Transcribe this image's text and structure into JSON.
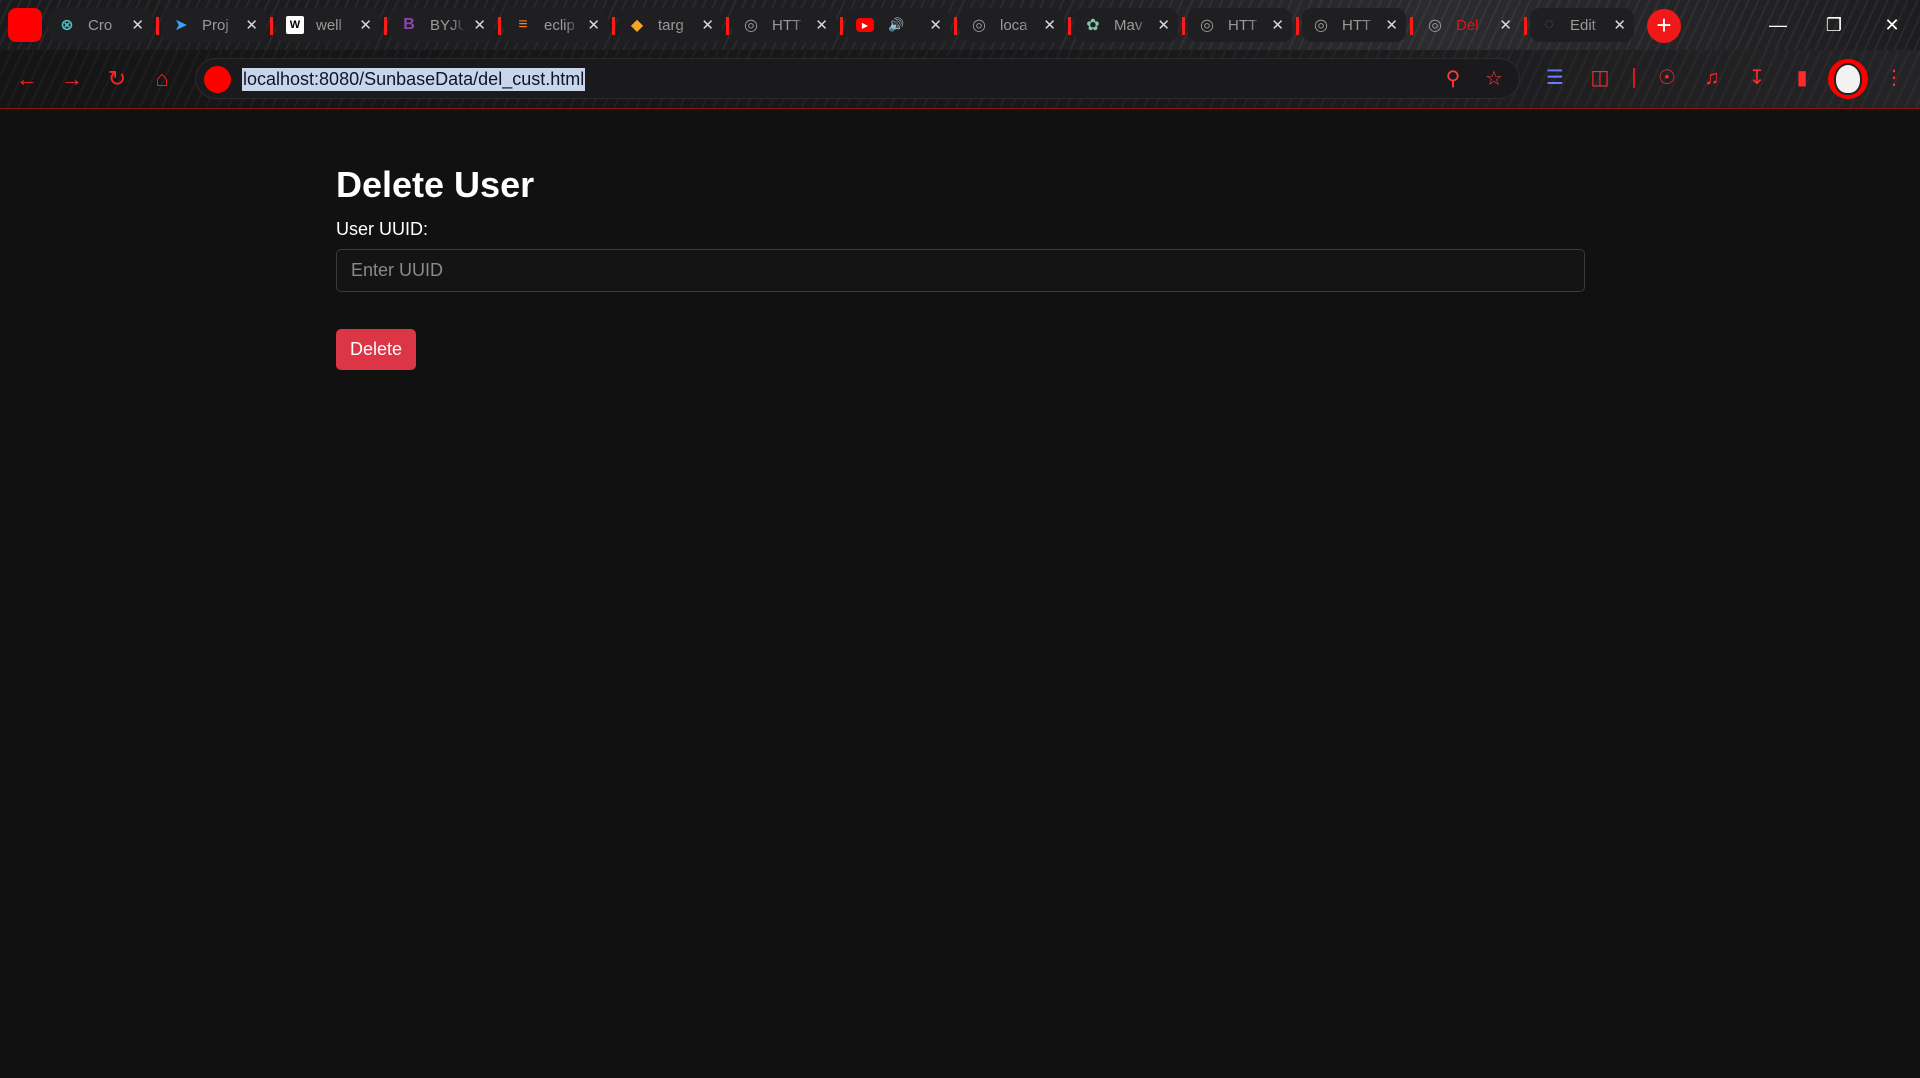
{
  "browser": {
    "tabs": [
      {
        "title": "Cro",
        "icon": "crossed-circle-icon",
        "color": "#4fc3c8"
      },
      {
        "title": "Proj",
        "icon": "bird-icon",
        "color": "#3aa0ff"
      },
      {
        "title": "well",
        "icon": "w-square-icon",
        "color": "#ffffff"
      },
      {
        "title": "BYJU",
        "icon": "b-logo-icon",
        "color": "#8e44ad"
      },
      {
        "title": "eclip",
        "icon": "stack-icon",
        "color": "#f48024"
      },
      {
        "title": "targ",
        "icon": "brave-icon",
        "color": "#f5a623"
      },
      {
        "title": "HTT",
        "icon": "globe-icon",
        "color": "#9a9a9a"
      },
      {
        "title": "",
        "icon": "youtube-icon",
        "color": "#ff0000",
        "audio": true
      },
      {
        "title": "loca",
        "icon": "globe-icon",
        "color": "#9a9a9a"
      },
      {
        "title": "Mav",
        "icon": "chatgpt-icon",
        "color": "#7fc8a9"
      },
      {
        "title": "HTT",
        "icon": "globe-icon",
        "color": "#9a9a9a"
      },
      {
        "title": "HTT",
        "icon": "globe-icon",
        "color": "#9a9a9a"
      },
      {
        "title": "Del",
        "icon": "globe-icon",
        "color": "#9a9a9a",
        "active": true
      },
      {
        "title": "Edit",
        "icon": "loading-icon",
        "color": "#555555"
      }
    ],
    "url": "localhost:8080/SunbaseData/del_cust.html",
    "accent": "#ff0000"
  },
  "page": {
    "title": "Delete User",
    "label": "User UUID:",
    "input_placeholder": "Enter UUID",
    "input_value": "",
    "button_label": "Delete",
    "button_color": "#dc3545"
  }
}
